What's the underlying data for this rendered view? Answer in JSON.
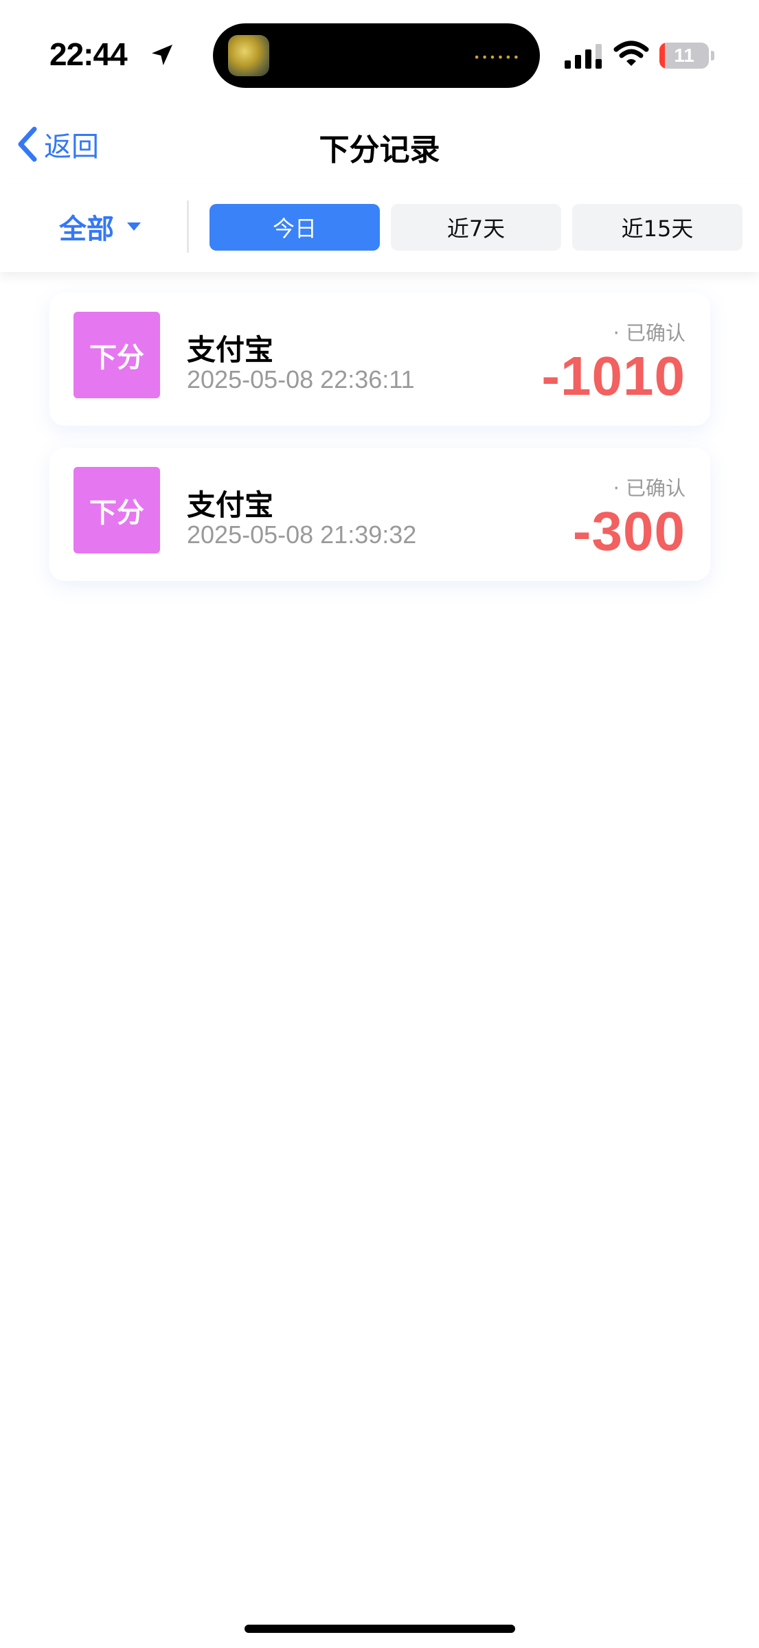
{
  "status_bar": {
    "time": "22:44",
    "battery_level": "11",
    "battery_fraction": 0.11,
    "location_icon": "location-arrow-icon",
    "signal_icon": "cellular-signal-icon",
    "wifi_icon": "wifi-icon",
    "battery_icon": "battery-icon",
    "island_dots": "••••••"
  },
  "nav": {
    "back_label": "返回",
    "back_icon": "chevron-left-icon",
    "title": "下分记录"
  },
  "filter": {
    "category": "全部",
    "category_icon": "caret-down-icon",
    "tabs": [
      {
        "label": "今日",
        "active": true
      },
      {
        "label": "近7天",
        "active": false
      },
      {
        "label": "近15天",
        "active": false
      }
    ]
  },
  "records": [
    {
      "badge": "下分",
      "method": "支付宝",
      "time": "2025-05-08 22:36:11",
      "status": "· 已确认",
      "amount": "-1010"
    },
    {
      "badge": "下分",
      "method": "支付宝",
      "time": "2025-05-08 21:39:32",
      "status": "· 已确认",
      "amount": "-300"
    }
  ],
  "colors": {
    "accent": "#3478f6",
    "active_tab": "#3a82f7",
    "badge_bg": "#e577f0",
    "amount": "#f2605f",
    "muted": "#9a9a9a",
    "battery_low": "#ff3b30"
  }
}
